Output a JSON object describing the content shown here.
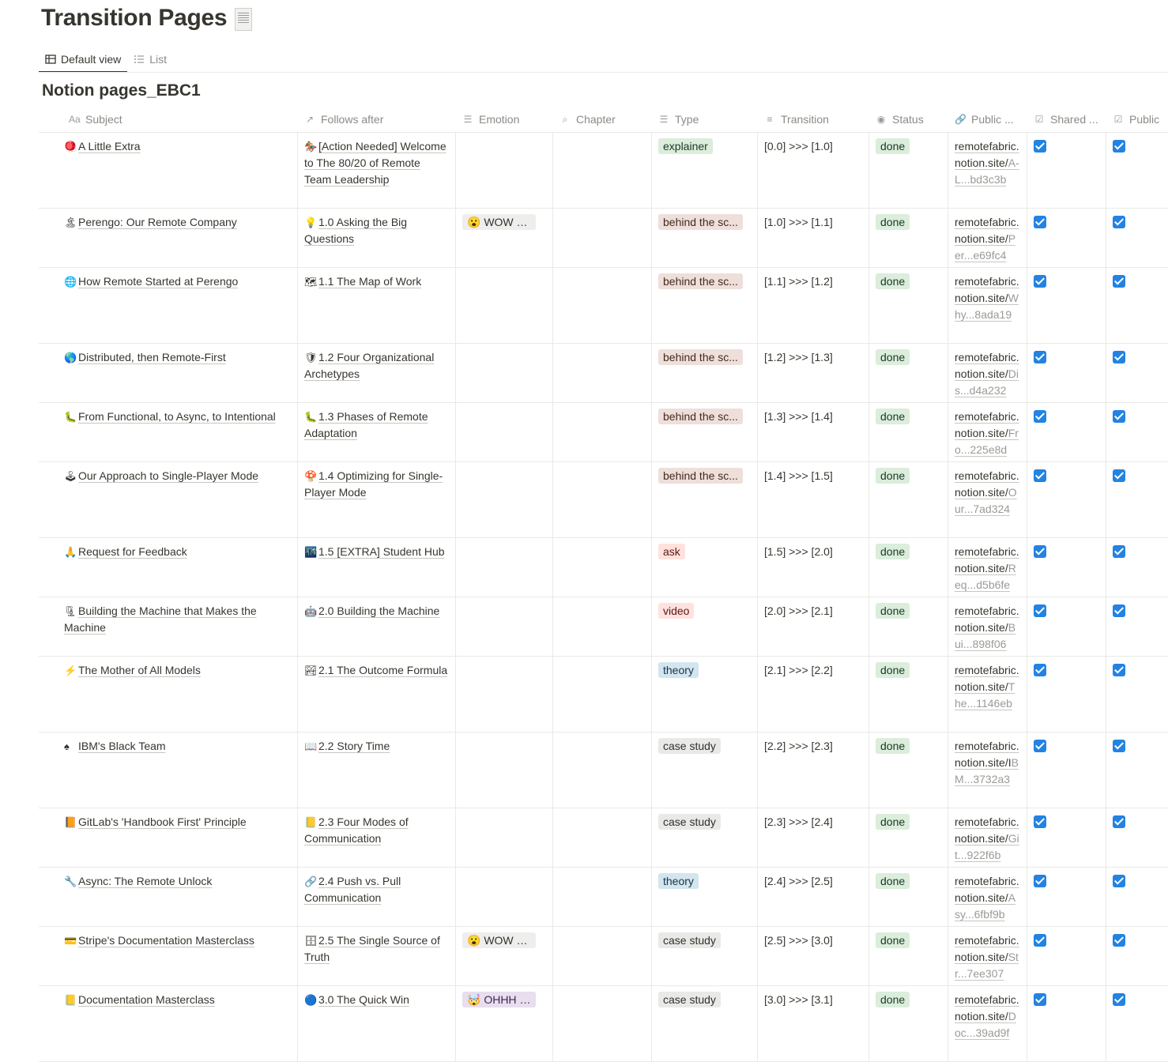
{
  "page": {
    "title": "Transition Pages",
    "title_icon": "receipt-icon"
  },
  "views": [
    {
      "label": "Default view",
      "icon": "table-icon",
      "active": true
    },
    {
      "label": "List",
      "icon": "list-icon",
      "active": false
    }
  ],
  "database": {
    "title": "Notion pages_EBC1"
  },
  "columns": [
    {
      "label": "Subject",
      "icon": "Aa"
    },
    {
      "label": "Follows after",
      "icon": "↗"
    },
    {
      "label": "Emotion",
      "icon": "☰"
    },
    {
      "label": "Chapter",
      "icon": "⌕"
    },
    {
      "label": "Type",
      "icon": "☰"
    },
    {
      "label": "Transition",
      "icon": "≡"
    },
    {
      "label": "Status",
      "icon": "◉"
    },
    {
      "label": "Public ...",
      "icon": "🔗"
    },
    {
      "label": "Shared ...",
      "icon": "☑"
    },
    {
      "label": "Public",
      "icon": "☑"
    }
  ],
  "colors": {
    "explainer": {
      "bg": "#dbeddb",
      "fg": "#1c3829"
    },
    "behind": {
      "bg": "#eedfdb",
      "fg": "#442a1e"
    },
    "ask": {
      "bg": "#ffe2dd",
      "fg": "#5d1715"
    },
    "video": {
      "bg": "#ffe2dd",
      "fg": "#5d1715"
    },
    "theory": {
      "bg": "#d3e5ef",
      "fg": "#183347"
    },
    "case": {
      "bg": "#e9e9e7",
      "fg": "#32302c"
    },
    "done": {
      "bg": "#dbeddb",
      "fg": "#1c3829"
    },
    "wow": {
      "bg": "#eeeeec",
      "fg": "#32302c"
    },
    "ohhh": {
      "bg": "#e8deee",
      "fg": "#412454"
    },
    "checkbox": "#2383e2"
  },
  "rows": [
    {
      "h": 95,
      "subject": "A Little Extra",
      "subject_icon": "🪀",
      "follows": "[Action Needed] Welcome to The 80/20 of Remote Team Leadership",
      "follows_icon": "🏇",
      "emotion": "",
      "chapter": "",
      "type": "explainer",
      "type_color": "explainer",
      "transition": "[0.0] >>> [1.0]",
      "status": "done",
      "url_main": "remotefabric.notion.site/",
      "url_sub": "A-L...bd3c3b"
    },
    {
      "h": 74,
      "subject": "Perengo: Our Remote Company",
      "subject_icon": "🏝",
      "follows": "1.0 Asking the Big Questions",
      "follows_icon": "💡",
      "emotion": "😮 WOW - t...",
      "emotion_color": "wow",
      "chapter": "",
      "type": "behind the sc...",
      "type_color": "behind",
      "transition": "[1.0] >>> [1.1]",
      "status": "done",
      "url_main": "remotefabric.notion.site/",
      "url_sub": "Per...e69fc4"
    },
    {
      "h": 95,
      "subject": "How Remote Started at Perengo",
      "subject_icon": "🌐",
      "follows": "1.1 The Map of Work",
      "follows_icon": "🗺",
      "emotion": "",
      "chapter": "",
      "type": "behind the sc...",
      "type_color": "behind",
      "transition": "[1.1] >>> [1.2]",
      "status": "done",
      "url_main": "remotefabric.notion.site/",
      "url_sub": "Why...8ada19"
    },
    {
      "h": 74,
      "subject": "Distributed, then Remote-First",
      "subject_icon": "🌎",
      "follows": "1.2 Four Organizational Archetypes",
      "follows_icon": "🛡",
      "emotion": "",
      "chapter": "",
      "type": "behind the sc...",
      "type_color": "behind",
      "transition": "[1.2] >>> [1.3]",
      "status": "done",
      "url_main": "remotefabric.notion.site/",
      "url_sub": "Dis...d4a232"
    },
    {
      "h": 74,
      "subject": "From Functional, to Async, to Intentional",
      "subject_icon": "🐛",
      "follows": "1.3 Phases of Remote Adaptation",
      "follows_icon": "🐛",
      "emotion": "",
      "chapter": "",
      "type": "behind the sc...",
      "type_color": "behind",
      "transition": "[1.3] >>> [1.4]",
      "status": "done",
      "url_main": "remotefabric.notion.site/",
      "url_sub": "Fro...225e8d"
    },
    {
      "h": 95,
      "subject": "Our Approach to Single-Player Mode",
      "subject_icon": "🕹",
      "follows": "1.4 Optimizing for Single-Player Mode",
      "follows_icon": "🍄",
      "emotion": "",
      "chapter": "",
      "type": "behind the sc...",
      "type_color": "behind",
      "transition": "[1.4] >>> [1.5]",
      "status": "done",
      "url_main": "remotefabric.notion.site/",
      "url_sub": "Our...7ad324"
    },
    {
      "h": 74,
      "subject": "Request for Feedback",
      "subject_icon": "🙏",
      "follows": "1.5 [EXTRA] Student Hub",
      "follows_icon": "🌃",
      "emotion": "",
      "chapter": "",
      "type": "ask",
      "type_color": "ask",
      "transition": "[1.5] >>> [2.0]",
      "status": "done",
      "url_main": "remotefabric.notion.site/",
      "url_sub": "Req...d5b6fe"
    },
    {
      "h": 74,
      "subject": "Building the Machine that Makes the Machine",
      "subject_icon": "🗜",
      "follows": "2.0 Building the Machine",
      "follows_icon": "🤖",
      "emotion": "",
      "chapter": "",
      "type": "video",
      "type_color": "video",
      "transition": "[2.0] >>> [2.1]",
      "status": "done",
      "url_main": "remotefabric.notion.site/",
      "url_sub": "Bui...898f06"
    },
    {
      "h": 95,
      "subject": "The Mother of All Models",
      "subject_icon": "⚡",
      "follows": "2.1 The Outcome Formula",
      "follows_icon": "🏞",
      "emotion": "",
      "chapter": "",
      "type": "theory",
      "type_color": "theory",
      "transition": "[2.1] >>> [2.2]",
      "status": "done",
      "url_main": "remotefabric.notion.site/",
      "url_sub": "The...1146eb"
    },
    {
      "h": 95,
      "subject": "IBM's Black Team",
      "subject_icon": "♠",
      "follows": "2.2 Story Time",
      "follows_icon": "📖",
      "emotion": "",
      "chapter": "",
      "type": "case study",
      "type_color": "case",
      "transition": "[2.2] >>> [2.3]",
      "status": "done",
      "url_main": "remotefabric.notion.site/I",
      "url_sub": "BM...3732a3"
    },
    {
      "h": 74,
      "subject": "GitLab's 'Handbook First' Principle",
      "subject_icon": "📙",
      "follows": "2.3 Four Modes of Communication",
      "follows_icon": "📒",
      "emotion": "",
      "chapter": "",
      "type": "case study",
      "type_color": "case",
      "transition": "[2.3] >>> [2.4]",
      "status": "done",
      "url_main": "remotefabric.notion.site/",
      "url_sub": "Git...922f6b"
    },
    {
      "h": 74,
      "subject": "Async: The Remote Unlock",
      "subject_icon": "🔧",
      "follows": "2.4 Push vs. Pull Communication",
      "follows_icon": "🔗",
      "emotion": "",
      "chapter": "",
      "type": "theory",
      "type_color": "theory",
      "transition": "[2.4] >>> [2.5]",
      "status": "done",
      "url_main": "remotefabric.notion.site/",
      "url_sub": "Asy...6fbf9b"
    },
    {
      "h": 74,
      "subject": "Stripe's Documentation Masterclass",
      "subject_icon": "💳",
      "follows": "2.5 The Single Source of Truth",
      "follows_icon": "🗄",
      "emotion": "😮 WOW - t...",
      "emotion_color": "wow",
      "chapter": "",
      "type": "case study",
      "type_color": "case",
      "transition": "[2.5] >>> [3.0]",
      "status": "done",
      "url_main": "remotefabric.notion.site/",
      "url_sub": "Str...7ee307"
    },
    {
      "h": 95,
      "subject": "Documentation Masterclass",
      "subject_icon": "📒",
      "follows": "3.0 The Quick Win",
      "follows_icon": "🔵",
      "emotion": "🤯 OHHH - ...",
      "emotion_color": "ohhh",
      "chapter": "",
      "type": "case study",
      "type_color": "case",
      "transition": "[3.0] >>> [3.1]",
      "status": "done",
      "url_main": "remotefabric.notion.site/",
      "url_sub": "Doc...39ad9f"
    }
  ]
}
